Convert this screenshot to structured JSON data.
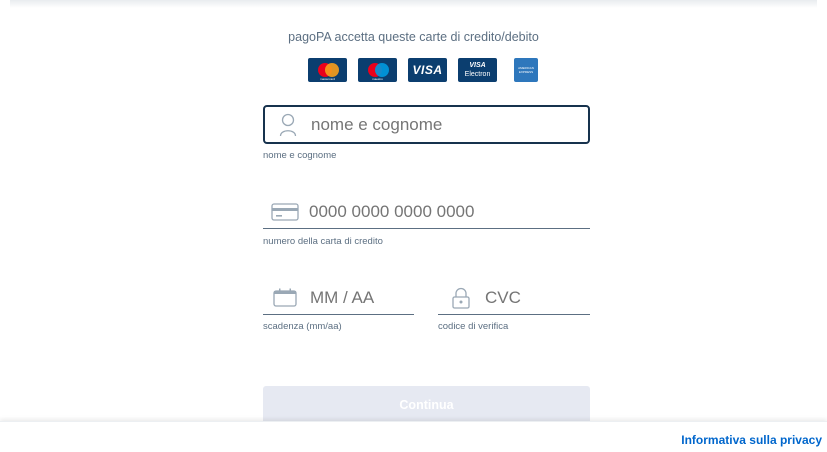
{
  "header": {
    "accepted_cards_text": "pagoPA accetta queste carte di credito/debito"
  },
  "cards": [
    {
      "name": "mastercard",
      "label": "mastercard"
    },
    {
      "name": "maestro",
      "label": "maestro"
    },
    {
      "name": "visa",
      "label": "VISA"
    },
    {
      "name": "visa-electron",
      "label_top": "VISA",
      "label_bottom": "Electron"
    },
    {
      "name": "american-express",
      "label": "AMERICAN EXPRESS"
    }
  ],
  "form": {
    "name": {
      "placeholder": "nome e cognome",
      "value": "",
      "label": "nome e cognome",
      "icon": "user-icon"
    },
    "card_number": {
      "placeholder": "0000 0000 0000 0000",
      "value": "",
      "label": "numero della carta di credito",
      "icon": "credit-card-icon"
    },
    "expiry": {
      "placeholder": "MM / AA",
      "value": "",
      "label": "scadenza (mm/aa)",
      "icon": "calendar-icon"
    },
    "cvc": {
      "placeholder": "CVC",
      "value": "",
      "label": "codice di verifica",
      "icon": "lock-icon"
    }
  },
  "submit": {
    "label": "Continua",
    "enabled": false
  },
  "footer": {
    "privacy_link": "Informativa sulla privacy"
  },
  "colors": {
    "primary_dark": "#17324d",
    "text_muted": "#5c6f82",
    "placeholder": "#a9b6c2",
    "link": "#0066cc",
    "card_blue": "#0b3e6f",
    "button_disabled": "#e6e9f2"
  }
}
